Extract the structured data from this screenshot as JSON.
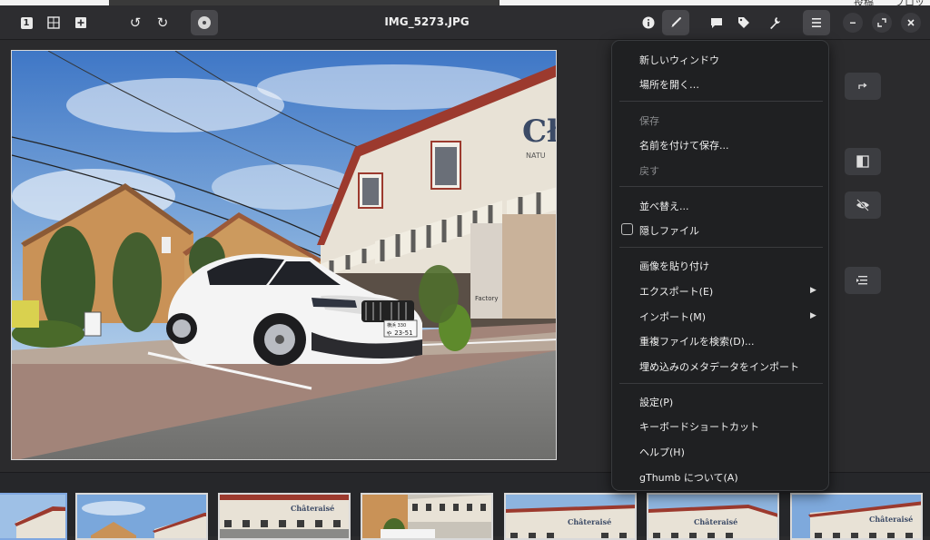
{
  "desktop": {
    "right_texts": [
      "投稿",
      "ブロッ"
    ]
  },
  "header": {
    "title": "IMG_5273.JPG",
    "buttons": {
      "view_single": "1",
      "rotate_left": "↺",
      "rotate_right": "↻"
    }
  },
  "menu": {
    "items": [
      {
        "label": "新しいウィンドウ",
        "enabled": true
      },
      {
        "label": "場所を開く…",
        "enabled": true
      },
      {
        "label": "保存",
        "enabled": false
      },
      {
        "label": "名前を付けて保存...",
        "enabled": true
      },
      {
        "label": "戻す",
        "enabled": false
      },
      {
        "label": "並べ替え...",
        "enabled": true
      },
      {
        "label": "隠しファイル",
        "enabled": true,
        "checkbox": true,
        "checked": false
      },
      {
        "label": "画像を貼り付け",
        "enabled": true
      },
      {
        "label": "エクスポート(E)",
        "enabled": true,
        "submenu": true
      },
      {
        "label": "インポート(M)",
        "enabled": true,
        "submenu": true
      },
      {
        "label": "重複ファイルを検索(D)...",
        "enabled": true
      },
      {
        "label": "埋め込みのメタデータをインポート",
        "enabled": true
      },
      {
        "label": "設定(P)",
        "enabled": true
      },
      {
        "label": "キーボードショートカット",
        "enabled": true
      },
      {
        "label": "ヘルプ(H)",
        "enabled": true
      },
      {
        "label": "gThumb について(A)",
        "enabled": true
      }
    ]
  },
  "photo": {
    "plate_top": "横浜 330",
    "plate_bottom": "ゃ 23-51",
    "storefront": "Cł",
    "storefront_sub": "NATU",
    "sign_text": "Factory"
  },
  "thumbnails": {
    "store_label": "Châteraisé"
  },
  "colors": {
    "background": "#2b2b2d",
    "menu_bg": "#1f2022",
    "accent": "#7fa7e0"
  }
}
